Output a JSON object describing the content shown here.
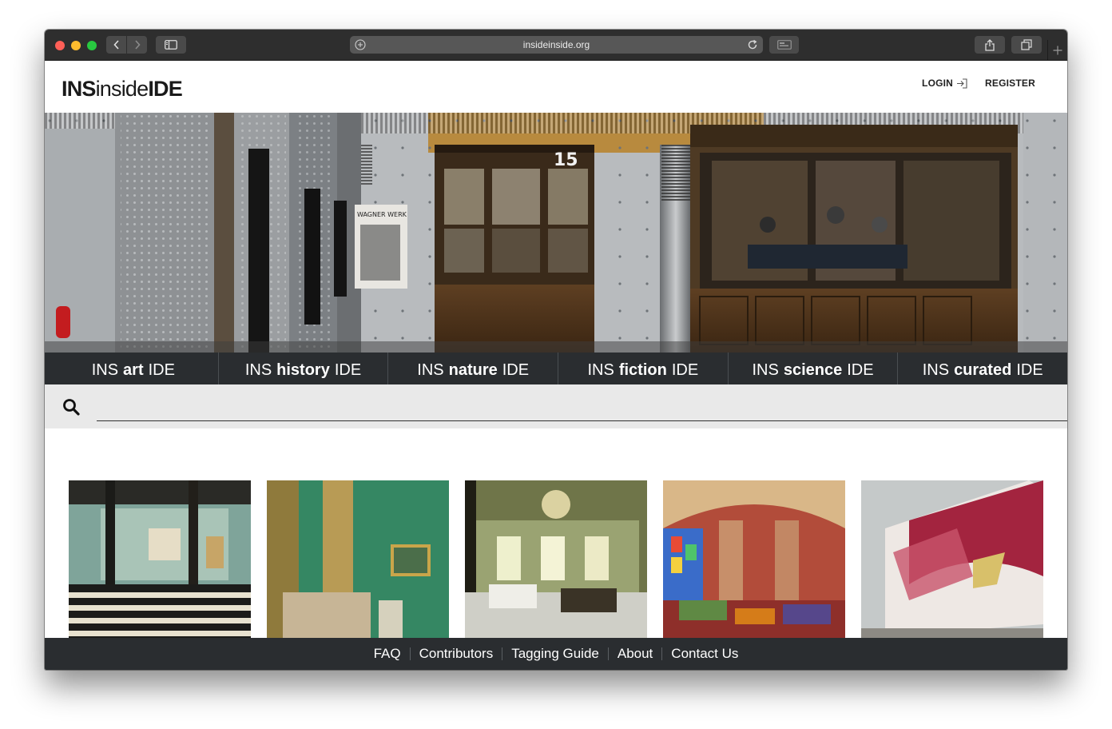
{
  "browser": {
    "url": "insideinside.org"
  },
  "header": {
    "logo_left": "INS",
    "logo_mid": "inside",
    "logo_right": "IDE",
    "login_label": "LOGIN",
    "register_label": "REGISTER"
  },
  "categories": [
    {
      "prefix": "INS",
      "word": "art",
      "suffix": "IDE"
    },
    {
      "prefix": "INS",
      "word": "history",
      "suffix": "IDE"
    },
    {
      "prefix": "INS",
      "word": "nature",
      "suffix": "IDE"
    },
    {
      "prefix": "INS",
      "word": "fiction",
      "suffix": "IDE"
    },
    {
      "prefix": "INS",
      "word": "science",
      "suffix": "IDE"
    },
    {
      "prefix": "INS",
      "word": "curated",
      "suffix": "IDE"
    }
  ],
  "search": {
    "placeholder": ""
  },
  "hero": {
    "booth_number": "15",
    "poster_text": "WAGNER WERK"
  },
  "footer": {
    "links": [
      "FAQ",
      "Contributors",
      "Tagging Guide",
      "About",
      "Contact Us"
    ]
  },
  "colors": {
    "nav_bar": "#2a2d30",
    "search_bg": "#e9e9e9",
    "chrome_bg": "#2e2e2e"
  }
}
